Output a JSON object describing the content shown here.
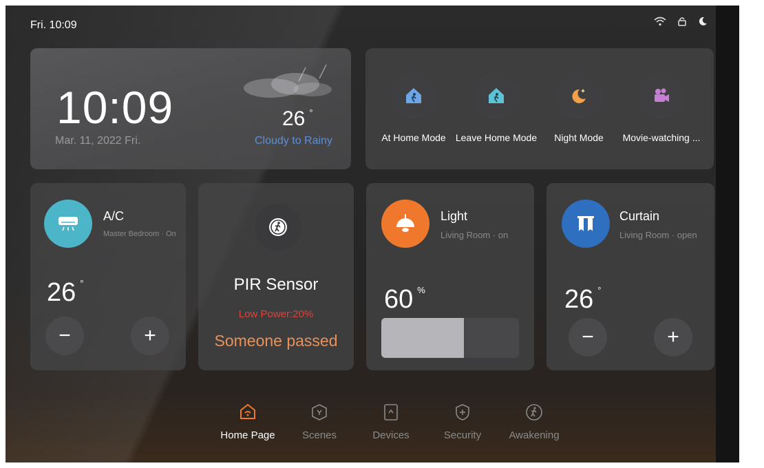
{
  "status": {
    "time": "Fri. 10:09",
    "icons": [
      "wifi-icon",
      "lock-icon",
      "moon-icon"
    ]
  },
  "clock": {
    "time": "10:09",
    "date": "Mar. 11, 2022  Fri."
  },
  "weather": {
    "temp": "26",
    "deg": "°",
    "text": "Cloudy to Rainy"
  },
  "modes": [
    {
      "label": "At Home Mode",
      "icon": "home-walk-icon"
    },
    {
      "label": "Leave Home Mode",
      "icon": "home-leave-icon"
    },
    {
      "label": "Night Mode",
      "icon": "moon-star-icon"
    },
    {
      "label": "Movie-watching ...",
      "icon": "movie-camera-icon"
    }
  ],
  "ac": {
    "title": "A/C",
    "sub": "Master Bedroom · On",
    "temp": "26",
    "deg": "°",
    "minus": "−",
    "plus": "+",
    "accent": "#4cb6c8"
  },
  "pir": {
    "title": "PIR Sensor",
    "power": "Low Power:20%",
    "status": "Someone passed"
  },
  "light": {
    "title": "Light",
    "sub": "Living Room · on",
    "level": "60",
    "unit": "%",
    "level_fraction": 0.6,
    "accent": "#f0782c"
  },
  "curtain": {
    "title": "Curtain",
    "sub": "Living Room · open",
    "temp": "26",
    "deg": "°",
    "minus": "−",
    "plus": "+",
    "accent": "#2e6fc0"
  },
  "nav": [
    {
      "label": "Home Page",
      "icon": "home-icon",
      "active": true
    },
    {
      "label": "Scenes",
      "icon": "scenes-icon",
      "active": false
    },
    {
      "label": "Devices",
      "icon": "devices-icon",
      "active": false
    },
    {
      "label": "Security",
      "icon": "shield-icon",
      "active": false
    },
    {
      "label": "Awakening",
      "icon": "walk-icon",
      "active": false
    }
  ],
  "colors": {
    "active_nav": "#f0782c",
    "inactive_nav": "#8a8a8a",
    "weather_text": "#5b8fd6",
    "low_power": "#d9443a",
    "pir_status": "#e8915a"
  }
}
